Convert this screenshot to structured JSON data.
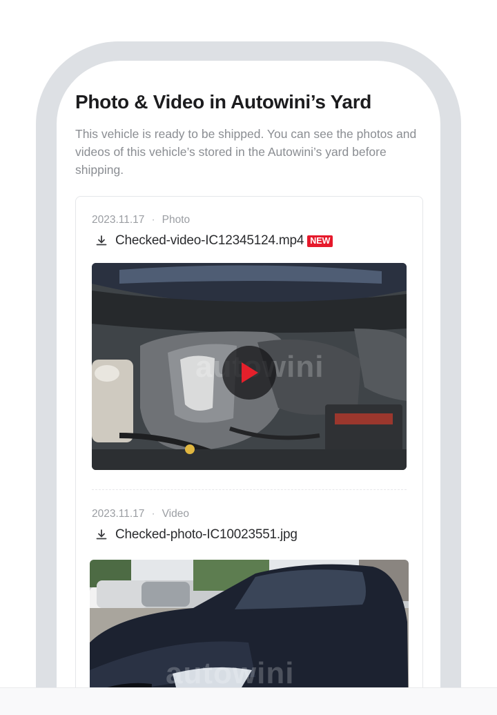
{
  "header": {
    "title": "Photo & Video in Autowini’s Yard",
    "description": "This vehicle is ready to be shipped. You can see the photos and videos of this vehicle’s stored in the Autowini’s yard before shipping."
  },
  "items": [
    {
      "date": "2023.11.17",
      "type": "Photo",
      "file_name": "Checked-video-IC12345124.mp4",
      "badge": "NEW",
      "media_kind": "video",
      "watermark": "autowini"
    },
    {
      "date": "2023.11.17",
      "type": "Video",
      "file_name": "Checked-photo-IC10023551.jpg",
      "media_kind": "photo",
      "watermark": "autowini"
    }
  ],
  "colors": {
    "badge": "#e6192b",
    "play_arrow": "#e5202b",
    "phone_frame": "#dde0e4"
  },
  "icons": {
    "download": "download-icon",
    "play": "play-icon"
  }
}
